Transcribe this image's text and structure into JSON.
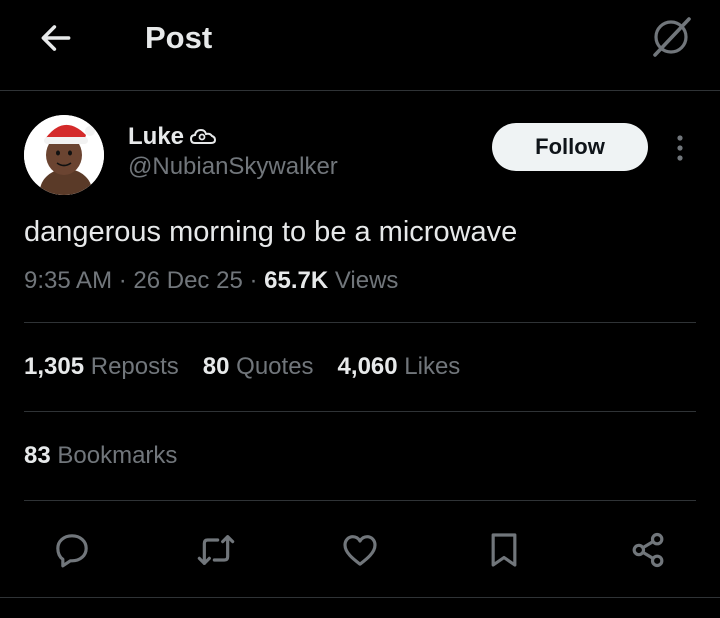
{
  "header": {
    "title": "Post",
    "back_icon": "arrow-left-icon",
    "grok_icon": "grok-icon"
  },
  "author": {
    "name": "Luke",
    "name_emoji": "cloud-emoji",
    "handle": "@NubianSkywalker",
    "avatar": "avatar"
  },
  "follow": {
    "label": "Follow"
  },
  "post": {
    "text": "dangerous morning to be a microwave"
  },
  "meta": {
    "time": "9:35 AM",
    "sep1": " · ",
    "date": "26 Dec 25",
    "sep2": " · ",
    "views_count": "65.7K",
    "views_label": "Views"
  },
  "stats": [
    {
      "num": "1,305",
      "label": "Reposts"
    },
    {
      "num": "80",
      "label": "Quotes"
    },
    {
      "num": "4,060",
      "label": "Likes"
    }
  ],
  "bookmarks": {
    "num": "83",
    "label": "Bookmarks"
  },
  "actions": [
    "reply-icon",
    "repost-icon",
    "like-icon",
    "bookmark-icon",
    "share-icon"
  ],
  "colors": {
    "background": "#000000",
    "text": "#e7e9ea",
    "muted": "#71767b",
    "divider": "#2f3336",
    "follow_bg": "#eff3f4"
  }
}
